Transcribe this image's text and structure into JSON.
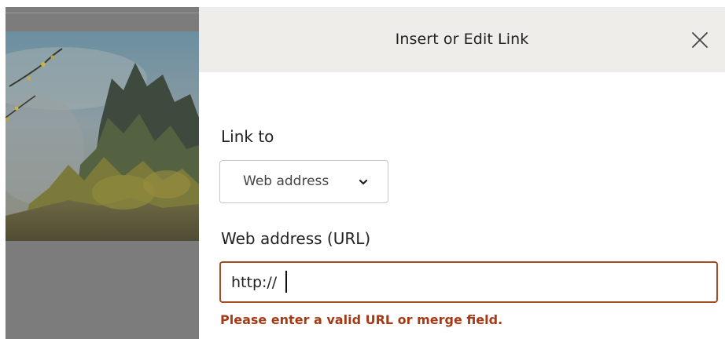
{
  "dialog": {
    "title": "Insert or Edit Link",
    "close_icon": "close-icon"
  },
  "link_to": {
    "label": "Link to",
    "selected": "Web address",
    "chevron_icon": "chevron-down-icon"
  },
  "url_field": {
    "label": "Web address (URL)",
    "value": "http://",
    "error": "Please enter a valid URL or merge field."
  },
  "colors": {
    "header_bg": "#efedea",
    "error": "#a63a14",
    "input_border_error": "#a54c25",
    "overlay": "#7c7c7c"
  }
}
